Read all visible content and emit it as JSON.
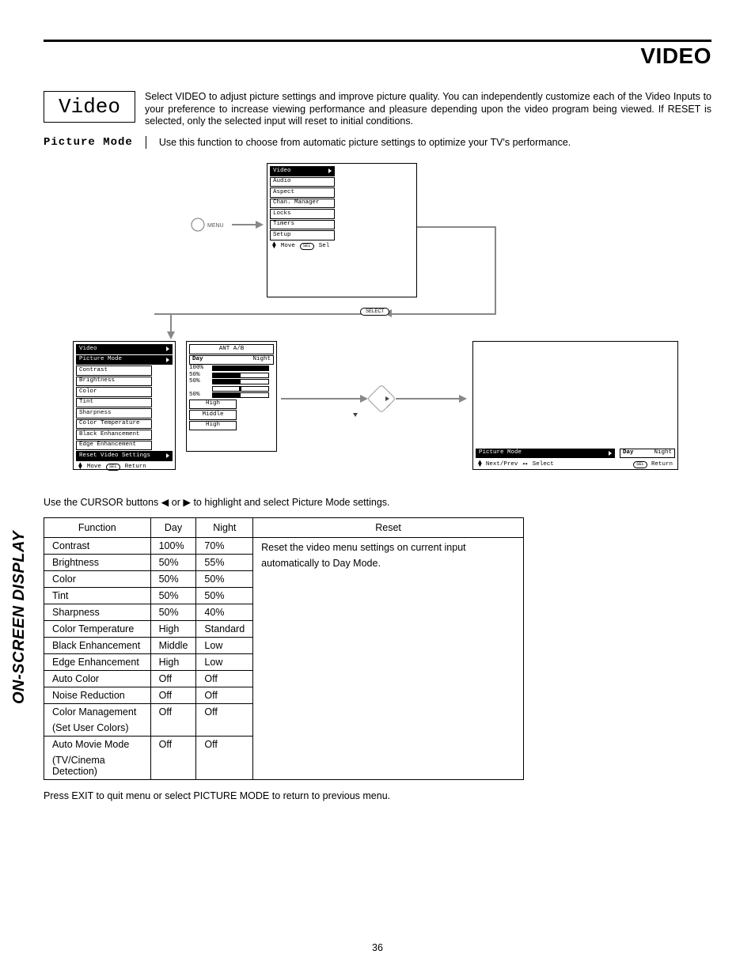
{
  "header": {
    "title": "VIDEO"
  },
  "video_box": {
    "label": "Video"
  },
  "intro": {
    "text": "Select VIDEO to adjust picture settings and improve picture quality.  You can independently customize each of the Video Inputs to your preference to increase viewing performance and pleasure depending upon the video program being viewed.  If RESET is selected, only the selected input will reset to initial conditions."
  },
  "picture_mode": {
    "label": "Picture Mode",
    "text": "Use this function to choose from automatic picture settings to optimize your TV's performance."
  },
  "sidebar": {
    "label": "ON-SCREEN DISPLAY"
  },
  "osd_main_menu": {
    "items": [
      "Video",
      "Audio",
      "Aspect",
      "Chan. Manager",
      "Locks",
      "Timers",
      "Setup"
    ],
    "footer_move": "Move",
    "footer_sel_pill": "SEL",
    "footer_sel": "Sel"
  },
  "osd_video_menu": {
    "title": "Video",
    "items": [
      "Picture Mode",
      "Contrast",
      "Brightness",
      "Color",
      "Tint",
      "Sharpness",
      "Color Temperature",
      "Black Enhancement",
      "Edge Enhancement",
      "Reset Video Settings"
    ],
    "footer_move": "Move",
    "footer_ret_pill": "SEL",
    "footer_return": "Return"
  },
  "osd_values": {
    "source": "ANT A/B",
    "picture_mode_day": "Day",
    "picture_mode_night": "Night",
    "contrast": "100%",
    "brightness": "50%",
    "color": "50%",
    "sharpness": "50%",
    "color_temp": "High",
    "black_enh": "Middle",
    "edge_enh": "High"
  },
  "osd_pm_bar": {
    "label": "Picture Mode",
    "day": "Day",
    "night": "Night",
    "footer_next": "Next/Prev",
    "footer_select": "Select",
    "footer_ret_pill": "SEL",
    "footer_return": "Return"
  },
  "menu_button": {
    "label": "MENU"
  },
  "select_button": {
    "label": "SELECT"
  },
  "cursor_note": {
    "pre": "Use the CURSOR buttons ",
    "mid": " or ",
    "post": " to highlight and select Picture Mode settings."
  },
  "table": {
    "headers": [
      "Function",
      "Day",
      "Night",
      "Reset"
    ],
    "rows": [
      {
        "fn": "Contrast",
        "day": "100%",
        "night": "70%"
      },
      {
        "fn": "Brightness",
        "day": "50%",
        "night": "55%"
      },
      {
        "fn": "Color",
        "day": "50%",
        "night": "50%"
      },
      {
        "fn": "Tint",
        "day": "50%",
        "night": "50%"
      },
      {
        "fn": "Sharpness",
        "day": "50%",
        "night": "40%"
      },
      {
        "fn": "Color Temperature",
        "day": "High",
        "night": "Standard"
      },
      {
        "fn": "Black Enhancement",
        "day": "Middle",
        "night": "Low"
      },
      {
        "fn": "Edge Enhancement",
        "day": "High",
        "night": "Low"
      },
      {
        "fn": "Auto Color",
        "day": "Off",
        "night": "Off"
      },
      {
        "fn": "Noise Reduction",
        "day": "Off",
        "night": "Off"
      },
      {
        "fn": "Color Management",
        "day": "Off",
        "night": "Off"
      },
      {
        "fn": "(Set User Colors)",
        "day": "",
        "night": ""
      },
      {
        "fn": "Auto Movie Mode",
        "day": "Off",
        "night": "Off"
      },
      {
        "fn": "(TV/Cinema Detection)",
        "day": "",
        "night": ""
      }
    ],
    "reset_text": "Reset the video menu settings on current input automatically to Day Mode."
  },
  "exit_note": {
    "text": "Press EXIT to quit menu or select PICTURE MODE to return to previous menu."
  },
  "page_number": "36"
}
